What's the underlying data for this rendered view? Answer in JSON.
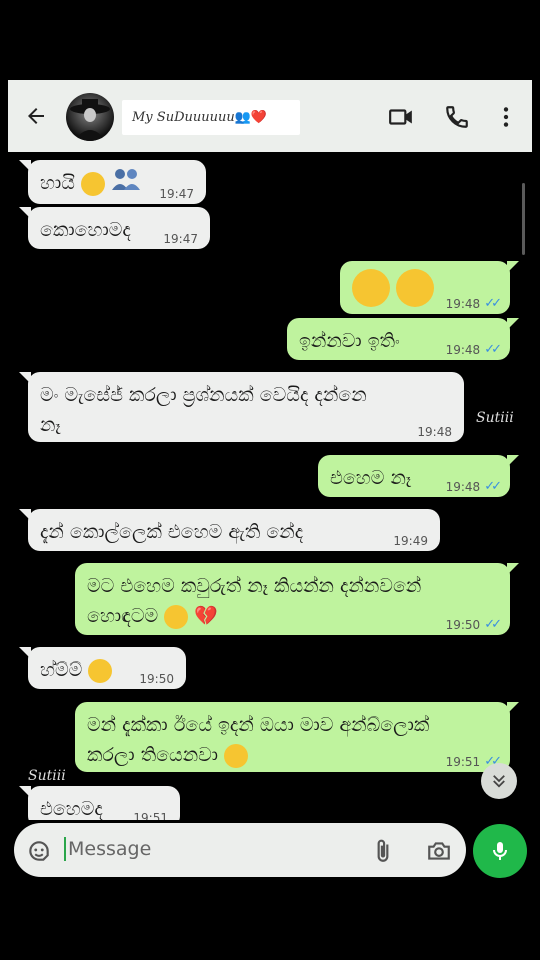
{
  "header": {
    "contact_name": "My SuDuuuuuu",
    "contact_emoji": "👥❤️"
  },
  "messages": [
    {
      "dir": "in",
      "text": "හායි",
      "time": "19:47"
    },
    {
      "dir": "in",
      "text": "කොහොමද",
      "time": "19:47"
    },
    {
      "dir": "out",
      "text": "",
      "time": "19:48"
    },
    {
      "dir": "out",
      "text": "ඉන්නවා ඉතිං",
      "time": "19:48"
    },
    {
      "dir": "in",
      "text": "මං මැසේජ් කරලා ප්‍රශ්නයක් වෙයිද දන්නෙ නෑ",
      "time": "19:48"
    },
    {
      "dir": "out",
      "text": "එහෙම නෑ",
      "time": "19:48"
    },
    {
      "dir": "in",
      "text": "දැන් කොල්ලෙක් එහෙම ඇති නේද",
      "time": "19:49"
    },
    {
      "dir": "out",
      "text": "මට එහෙම කවුරුත් නෑ කියන්න දන්නවනේ හොඳටම",
      "time": "19:50"
    },
    {
      "dir": "in",
      "text": "හ්ම්ම්",
      "time": "19:50"
    },
    {
      "dir": "out",
      "text": "මන් දැක්කා ඊයේ ඉදන් ඔයා මාව අන්බ්ලොක් කරලා තියෙනවා",
      "time": "19:51"
    },
    {
      "dir": "in",
      "text": "එහෙමද",
      "time": "19:51"
    }
  ],
  "signatures": [
    "Sutiii",
    "Sutiii"
  ],
  "input": {
    "placeholder": "Message"
  },
  "colors": {
    "incoming": "#eeefee",
    "outgoing": "#bff39e",
    "read_tick": "#3a8fe0",
    "mic": "#20b84a"
  }
}
